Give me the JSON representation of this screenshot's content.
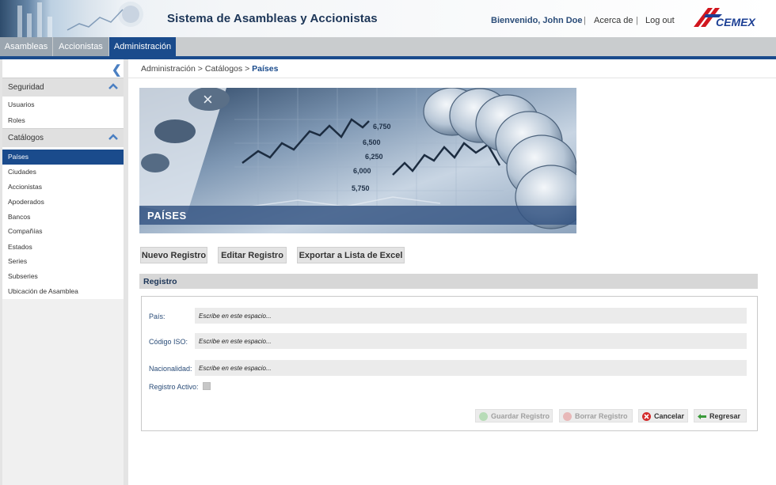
{
  "header": {
    "title": "Sistema de Asambleas y Accionistas",
    "welcome": "Bienvenido, John Doe",
    "separator": "|",
    "about_link": "Acerca de",
    "logout_link": "Log out",
    "logo_text": "CEMEX"
  },
  "nav": {
    "tabs": [
      {
        "label": "Asambleas",
        "active": false
      },
      {
        "label": "Accionistas",
        "active": false
      },
      {
        "label": "Administración",
        "active": true
      }
    ]
  },
  "sidebar": {
    "collapse_glyph": "❮",
    "sections": [
      {
        "label": "Seguridad",
        "items": [
          "Usuarios",
          "Roles"
        ]
      },
      {
        "label": "Catálogos",
        "items": [
          "Países",
          "Ciudades",
          "Accionistas",
          "Apoderados",
          "Bancos",
          "Compañías",
          "Estados",
          "Series",
          "Subseries",
          "Ubicación de Asamblea"
        ],
        "selected": "Países"
      }
    ]
  },
  "breadcrumb": {
    "part1": "Administración",
    "sep": ">",
    "part2": "Catálogos",
    "current": "Países"
  },
  "banner": {
    "title": "PAÍSES",
    "chart_labels": [
      "6,750",
      "6,500",
      "6,250",
      "6,000",
      "5,750"
    ]
  },
  "toolbar": {
    "new_label": "Nuevo Registro",
    "edit_label": "Editar Registro",
    "export_label": "Exportar a Lista de Excel"
  },
  "form": {
    "section_title": "Registro",
    "fields": [
      {
        "label": "País:",
        "placeholder": "Escribe en este espacio..."
      },
      {
        "label": "Código ISO:",
        "placeholder": "Escribe en este espacio..."
      },
      {
        "label": "Nacionalidad:",
        "placeholder": "Escribe en este espacio..."
      }
    ],
    "active_label": "Registro Activo:",
    "active_checked": false,
    "actions": {
      "save": "Guardar Registro",
      "delete": "Borrar Registro",
      "cancel": "Cancelar",
      "back": "Regresar"
    }
  },
  "colors": {
    "brand_blue": "#1a4b8c",
    "title_navy": "#1c3557",
    "logo_red": "#d1161e",
    "logo_blue": "#1c3f94",
    "cancel_red": "#d42a2a",
    "back_green": "#3a9a3a"
  }
}
